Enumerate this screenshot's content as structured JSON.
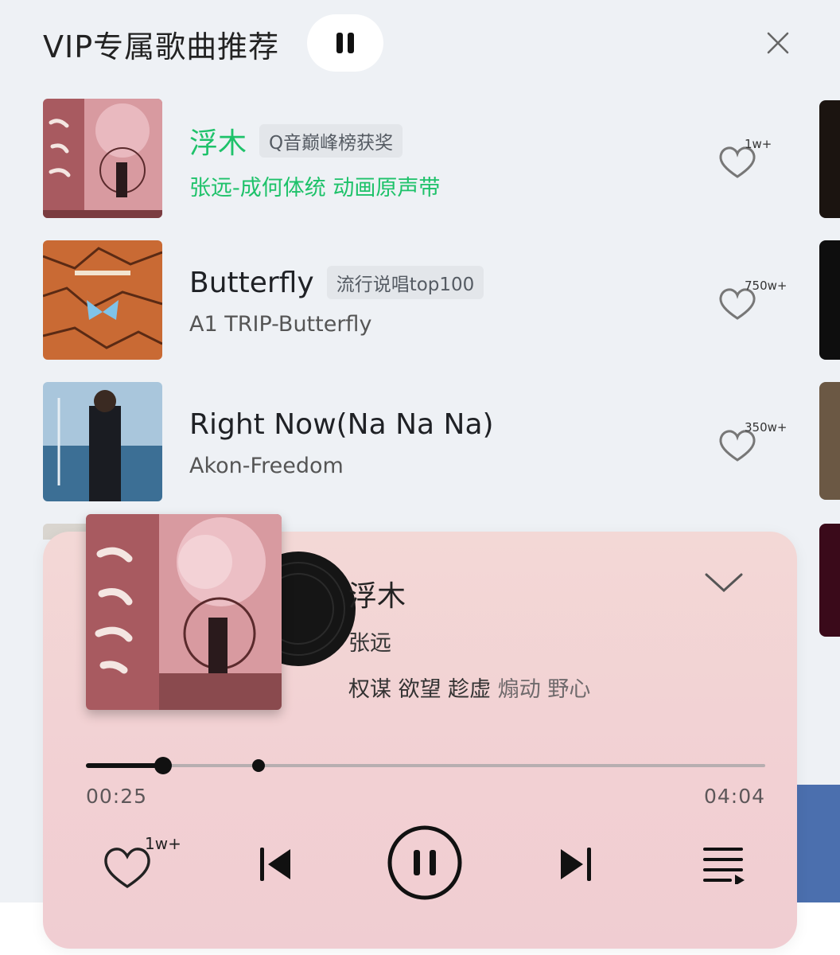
{
  "header": {
    "title": "VIP专属歌曲推荐"
  },
  "songs": [
    {
      "title": "浮木",
      "badge": "Q音巅峰榜获奖",
      "subtitle": "张远-成何体统 动画原声带",
      "likes": "1w+",
      "active": true
    },
    {
      "title": "Butterfly",
      "badge": "流行说唱top100",
      "subtitle": "A1 TRIP-Butterfly",
      "likes": "750w+",
      "active": false
    },
    {
      "title": "Right Now(Na Na Na)",
      "badge": "",
      "subtitle": "Akon-Freedom",
      "likes": "350w+",
      "active": false
    }
  ],
  "player": {
    "title": "浮木",
    "artist": "张远",
    "lyric_main": "权谋 欲望 趁虚",
    "lyric_dim": "煽动 野心",
    "current_time": "00:25",
    "total_time": "04:04",
    "progress_fraction": 0.114,
    "buffer_fraction": 0.254,
    "likes": "1w+"
  },
  "colors": {
    "accent": "#1ec26a",
    "player_bg": "#f2d2d4",
    "page_bg": "#eef1f5"
  },
  "icons": {
    "header_pause": "pause-icon",
    "close": "close-icon",
    "like": "heart-icon",
    "collapse": "chevron-down-icon",
    "prev": "skip-previous-icon",
    "play_pause": "pause-circle-icon",
    "next": "skip-next-icon",
    "playlist": "playlist-icon"
  }
}
